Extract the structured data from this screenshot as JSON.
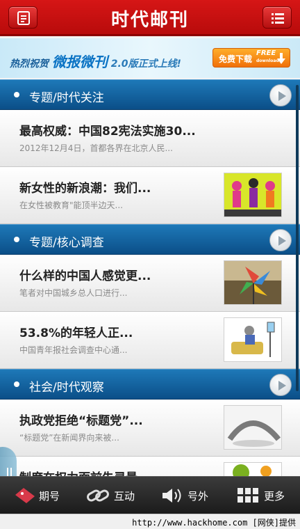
{
  "header": {
    "title": "时代邮刊"
  },
  "banner": {
    "prefix": "热烈祝贺",
    "brand": "微报微刊",
    "version": "2.0版正式上线!",
    "button_label": "免费下载",
    "button_free": "FREE",
    "button_download": "download"
  },
  "sections": [
    {
      "title": "专题/时代关注",
      "items": [
        {
          "title": "最高权威：中国82宪法实施30...",
          "summary": "2012年12月4日，首都各界在北京人民..."
        },
        {
          "title": "新女性的新浪潮：我们...",
          "summary": "在女性被教育\"能顶半边天..."
        }
      ]
    },
    {
      "title": "专题/核心调查",
      "items": [
        {
          "title": "什么样的中国人感觉更...",
          "summary": "笔者对中国城乡总人口进行..."
        },
        {
          "title": "53.8%的年轻人正...",
          "summary": "中国青年报社会调查中心通..."
        }
      ]
    },
    {
      "title": "社会/时代观察",
      "items": [
        {
          "title": "执政党拒绝“标题党”...",
          "summary": "“标题党”在新闻界向来被..."
        },
        {
          "title": "制度在权力面前失灵最",
          "summary": ""
        }
      ]
    }
  ],
  "tabs": [
    "期号",
    "互动",
    "号外",
    "更多"
  ],
  "footer": {
    "text": "http://www.hackhome.com [网侠]提供"
  },
  "colors": {
    "header": "#c81010",
    "section": "#0b4f88",
    "tabbar": "#2a2a2a"
  }
}
